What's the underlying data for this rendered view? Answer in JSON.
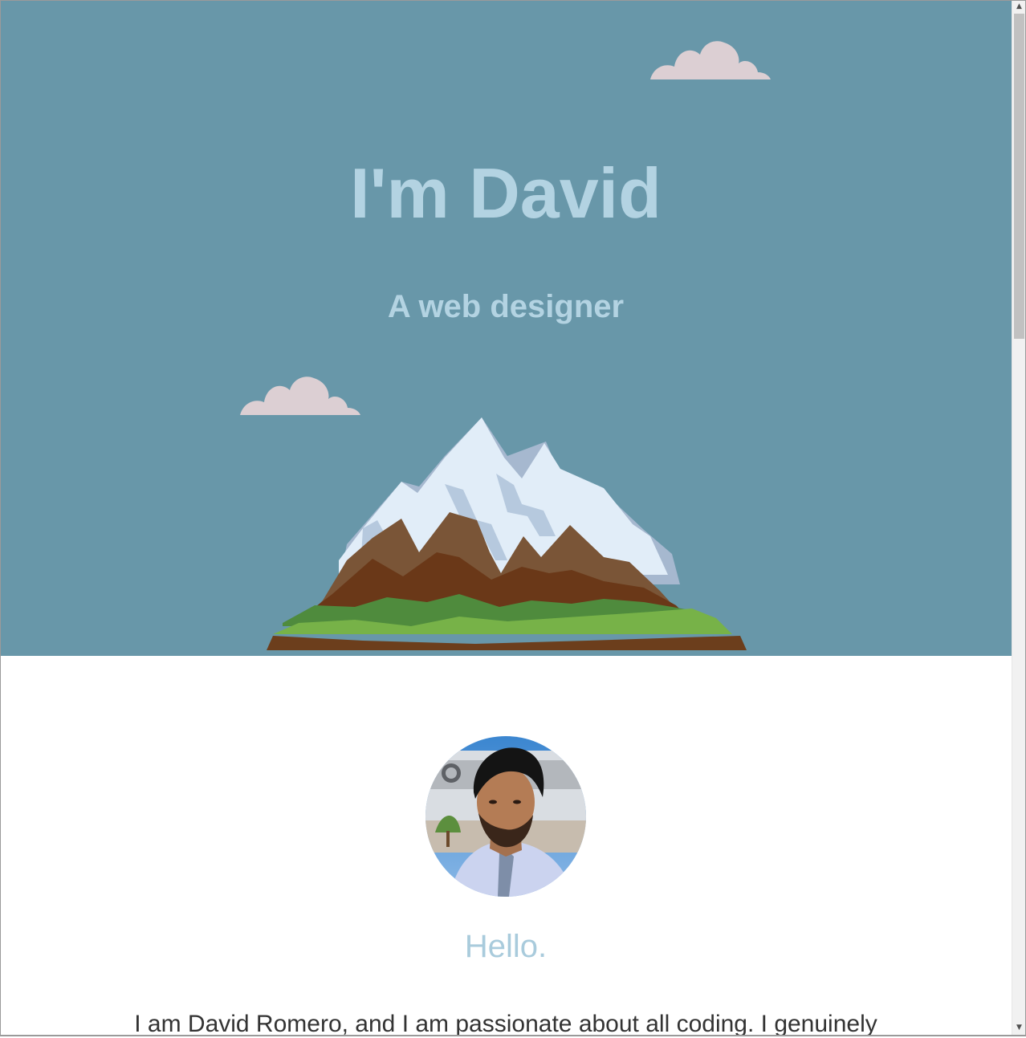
{
  "hero": {
    "title": "I'm David",
    "subtitle": "A web designer"
  },
  "about": {
    "avatar_alt": "David Romero portrait",
    "greeting": "Hello.",
    "intro": "I am David Romero, and I am passionate about all coding. I genuinely"
  },
  "scrollbar": {
    "up_icon": "scroll-up-arrow",
    "down_icon": "scroll-down-arrow"
  },
  "colors": {
    "hero_background": "#6897a9",
    "hero_text": "#b3d3e2",
    "cloud": "#dccfd3",
    "greeting": "#a9cbdc",
    "body_text": "#333333"
  }
}
